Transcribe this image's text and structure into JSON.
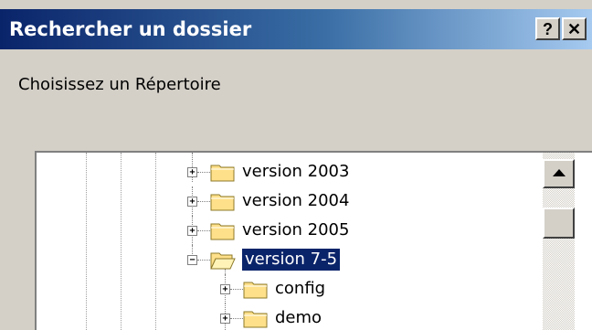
{
  "dialog": {
    "title": "Rechercher un dossier",
    "help_label": "?",
    "close_label": "✕"
  },
  "prompt": "Choisissez un Répertoire",
  "tree": {
    "items": [
      {
        "label": "version 2003",
        "expander": "+",
        "icon": "folder-closed-icon",
        "selected": false
      },
      {
        "label": "version 2004",
        "expander": "+",
        "icon": "folder-closed-icon",
        "selected": false
      },
      {
        "label": "version 2005",
        "expander": "+",
        "icon": "folder-closed-icon",
        "selected": false
      },
      {
        "label": "version 7-5",
        "expander": "−",
        "icon": "folder-open-icon",
        "selected": true
      },
      {
        "label": "config",
        "expander": "+",
        "icon": "folder-closed-icon",
        "selected": false
      },
      {
        "label": "demo",
        "expander": "+",
        "icon": "folder-closed-icon",
        "selected": false
      }
    ]
  },
  "colors": {
    "title_bar": "#0a246a",
    "selection": "#0a246a",
    "folder": "#ffe08a"
  }
}
